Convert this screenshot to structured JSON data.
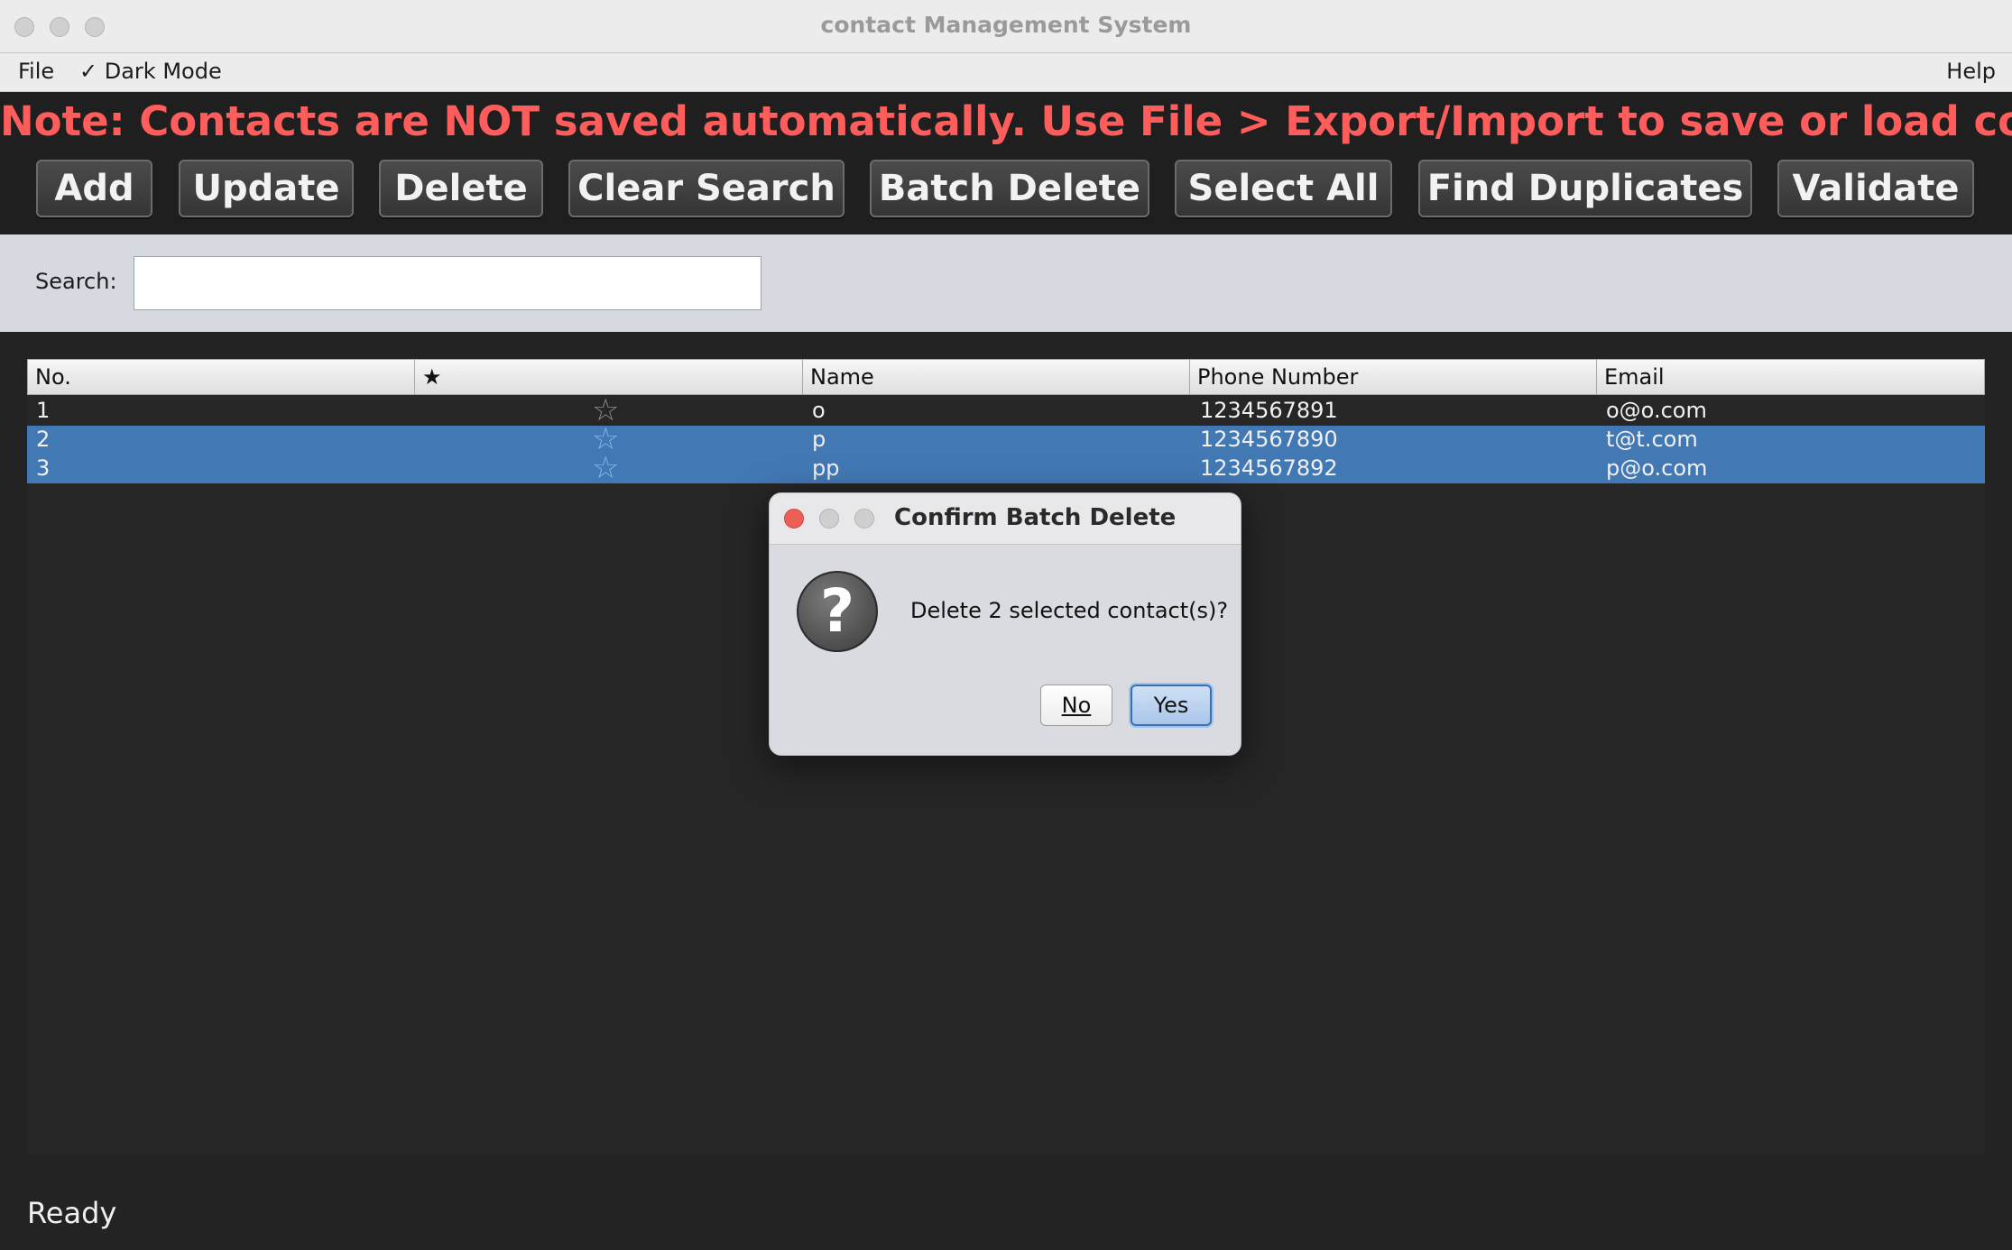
{
  "window": {
    "title": "contact Management System"
  },
  "menu": {
    "file": "File",
    "dark_mode": "✓ Dark Mode",
    "help": "Help"
  },
  "note": "Note: Contacts are NOT saved automatically. Use File > Export/Import to save or load contacts.",
  "toolbar": {
    "add": "Add",
    "update": "Update",
    "delete": "Delete",
    "clear_search": "Clear Search",
    "batch_delete": "Batch Delete",
    "select_all": "Select All",
    "find_duplicates": "Find Duplicates",
    "validate": "Validate"
  },
  "search": {
    "label": "Search:",
    "value": ""
  },
  "table": {
    "headers": [
      "No.",
      "★",
      "Name",
      "Phone Number",
      "Email"
    ],
    "rows": [
      {
        "no": "1",
        "star": "☆",
        "name": "o",
        "phone": "1234567891",
        "email": "o@o.com",
        "selected": false
      },
      {
        "no": "2",
        "star": "☆",
        "name": "p",
        "phone": "1234567890",
        "email": "t@t.com",
        "selected": true
      },
      {
        "no": "3",
        "star": "☆",
        "name": "pp",
        "phone": "1234567892",
        "email": "p@o.com",
        "selected": true
      }
    ]
  },
  "status": "Ready",
  "dialog": {
    "title": "Confirm Batch Delete",
    "icon": "question-icon",
    "icon_glyph": "?",
    "message": "Delete 2 selected contact(s)?",
    "no_label": "No",
    "yes_label": "Yes"
  },
  "colors": {
    "note": "#ff5c5c",
    "selection": "#4279b5",
    "background": "#232323",
    "close_dot": "#ec5f57"
  }
}
